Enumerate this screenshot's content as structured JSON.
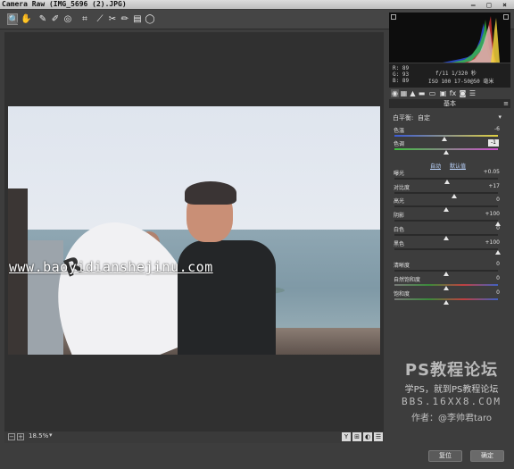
{
  "window": {
    "title": "Camera Raw (IMG_5696 (2).JPG)",
    "controls": "– □ ×"
  },
  "toolbar": {
    "tools": [
      {
        "name": "zoom-tool",
        "glyph": "🔍"
      },
      {
        "name": "hand-tool",
        "glyph": "✋"
      },
      {
        "name": "white-balance-tool",
        "glyph": "✎"
      },
      {
        "name": "color-sampler-tool",
        "glyph": "✐"
      },
      {
        "name": "targeted-adjustment-tool",
        "glyph": "◎"
      },
      {
        "name": "crop-tool",
        "glyph": "⌗"
      },
      {
        "name": "straighten-tool",
        "glyph": "⟋"
      },
      {
        "name": "spot-removal-tool",
        "glyph": "✂"
      },
      {
        "name": "red-eye-tool",
        "glyph": "✏"
      },
      {
        "name": "adjustment-brush-tool",
        "glyph": "▤"
      },
      {
        "name": "graduated-filter-tool",
        "glyph": "◯"
      }
    ],
    "open_prefs_glyph": "⇱"
  },
  "photo": {
    "watermark_url": "www.baoyidianshejinu.com",
    "board_logo": "R"
  },
  "canvas_bar": {
    "zoom_value": "18.5%",
    "zoom_caret": "▾",
    "view_buttons": [
      "Y",
      "⊞",
      "◐",
      "☰"
    ]
  },
  "info": {
    "r": "R:  89",
    "g": "G:  93",
    "b": "B:  89",
    "exif_line1": "f/11   1/320 秒",
    "exif_line2": "ISO 100   17-50@50 毫米"
  },
  "panel_tabs": [
    "◉",
    "▦",
    "▲",
    "▬",
    "▭",
    "▣",
    "fx",
    "◙",
    "☰"
  ],
  "panel": {
    "title": "基本",
    "menu": "≡",
    "white_balance_label": "白平衡:",
    "white_balance_value": "自定",
    "white_balance_caret": "▾",
    "auto_label": "自动",
    "default_label": "默认值"
  },
  "sliders": [
    {
      "id": "temperature",
      "label": "色温",
      "value": "-6",
      "pos": 0.48
    },
    {
      "id": "tint",
      "label": "色调",
      "value": "-1",
      "pos": 0.5,
      "editing": true
    },
    {
      "id": "exposure",
      "label": "曝光",
      "value": "+0.05",
      "pos": 0.51
    },
    {
      "id": "contrast",
      "label": "对比度",
      "value": "+17",
      "pos": 0.58
    },
    {
      "id": "highlights",
      "label": "高光",
      "value": "0",
      "pos": 0.5
    },
    {
      "id": "shadows",
      "label": "阴影",
      "value": "+100",
      "pos": 1.0
    },
    {
      "id": "whites",
      "label": "白色",
      "value": "0",
      "pos": 0.5
    },
    {
      "id": "blacks",
      "label": "黑色",
      "value": "+100",
      "pos": 1.0
    },
    {
      "id": "clarity",
      "label": "清晰度",
      "value": "0",
      "pos": 0.5
    },
    {
      "id": "vibrance",
      "label": "自然饱和度",
      "value": "0",
      "pos": 0.5
    },
    {
      "id": "saturation",
      "label": "饱和度",
      "value": "0",
      "pos": 0.5
    }
  ],
  "watermark": {
    "line1": "PS教程论坛",
    "line2": "学PS，就到PS教程论坛",
    "line3": "BBS.16XX8.COM",
    "line4": "作者：@李帅君taro"
  },
  "buttons": {
    "reset": "复位",
    "ok": "确定"
  },
  "colors": {
    "background": "#3d3d3d",
    "histogram_bg": "#0d0d0d",
    "temperature_grad_start": "#3b5bd6",
    "temperature_grad_end": "#e0d040",
    "tint_grad_start": "#3fbf3f",
    "tint_grad_end": "#d04fd0"
  }
}
